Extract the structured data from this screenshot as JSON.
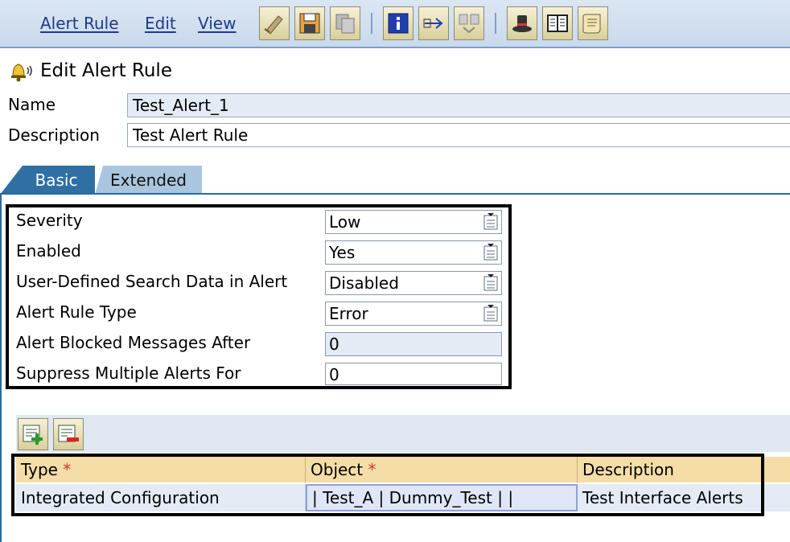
{
  "menu": {
    "items": [
      "Alert Rule",
      "Edit",
      "View"
    ]
  },
  "toolbar": {
    "icons": [
      "edit-pencil-icon",
      "save-icon",
      "copy-icon",
      "info-icon",
      "transport-icon",
      "compare-icon",
      "hat-icon",
      "book-icon",
      "scroll-icon"
    ]
  },
  "page": {
    "title": "Edit Alert Rule"
  },
  "header_fields": {
    "name_label": "Name",
    "name_value": "Test_Alert_1",
    "description_label": "Description",
    "description_value": "Test Alert Rule"
  },
  "tabs": {
    "basic": "Basic",
    "extended": "Extended"
  },
  "settings": {
    "severity_label": "Severity",
    "severity_value": "Low",
    "enabled_label": "Enabled",
    "enabled_value": "Yes",
    "search_label": "User-Defined Search Data in Alert",
    "search_value": "Disabled",
    "type_label": "Alert Rule Type",
    "type_value": "Error",
    "blocked_label": "Alert Blocked Messages After",
    "blocked_value": "0",
    "suppress_label": "Suppress Multiple Alerts For",
    "suppress_value": "0"
  },
  "table": {
    "headers": {
      "type": "Type",
      "object": "Object",
      "description": "Description"
    },
    "required_mark": "*",
    "rows": [
      {
        "type": "Integrated Configuration",
        "object": "| Test_A | Dummy_Test |  |",
        "description": "Test Interface Alerts"
      }
    ]
  }
}
